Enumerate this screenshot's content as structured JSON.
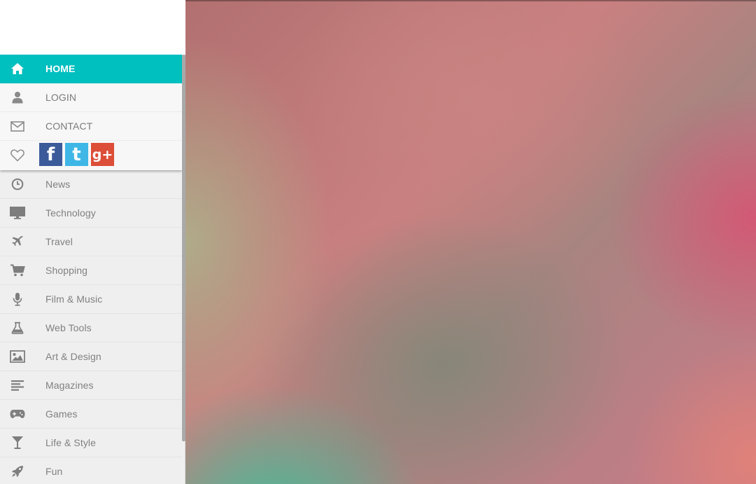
{
  "primary_menu": {
    "home": "HOME",
    "login": "LOGIN",
    "contact": "CONTACT"
  },
  "social": {
    "facebook_glyph": "f",
    "twitter_glyph": "t",
    "googleplus_glyph": "g+"
  },
  "categories": [
    {
      "label": "News",
      "icon": "clock-icon"
    },
    {
      "label": "Technology",
      "icon": "monitor-icon"
    },
    {
      "label": "Travel",
      "icon": "airplane-icon"
    },
    {
      "label": "Shopping",
      "icon": "cart-icon"
    },
    {
      "label": "Film & Music",
      "icon": "microphone-icon"
    },
    {
      "label": "Web Tools",
      "icon": "flask-icon"
    },
    {
      "label": "Art & Design",
      "icon": "image-icon"
    },
    {
      "label": "Magazines",
      "icon": "align-left-icon"
    },
    {
      "label": "Games",
      "icon": "gamepad-icon"
    },
    {
      "label": "Life & Style",
      "icon": "glass-icon"
    },
    {
      "label": "Fun",
      "icon": "rocket-icon"
    }
  ],
  "colors": {
    "active": "#00bfbf",
    "facebook": "#3b5a9a",
    "twitter": "#3fb7e6",
    "googleplus": "#dc4e38"
  }
}
